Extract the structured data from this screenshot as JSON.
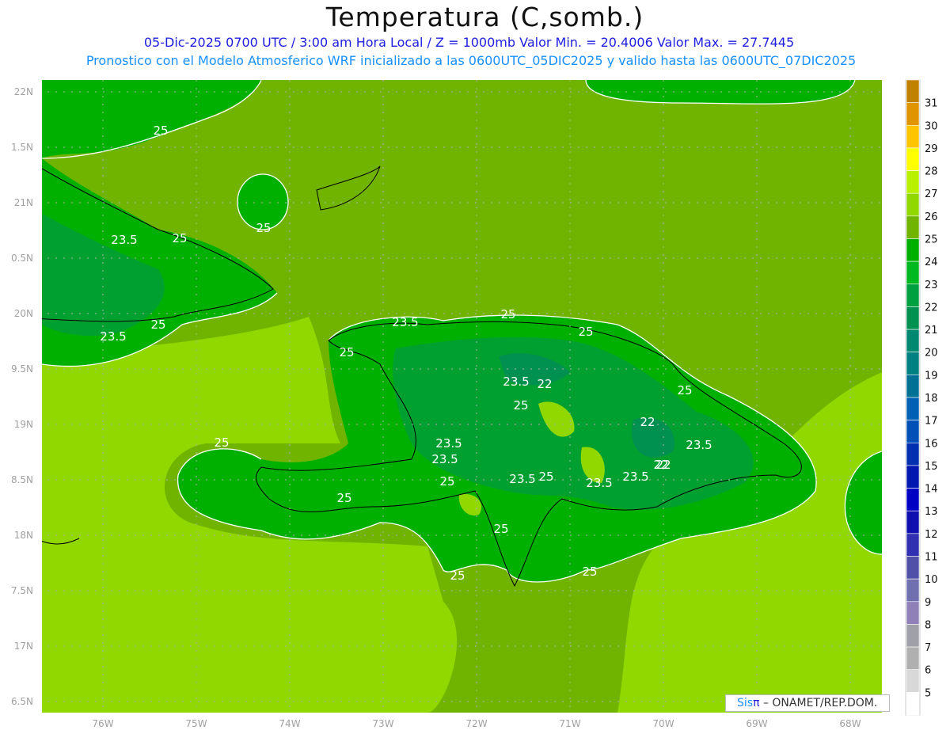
{
  "header": {
    "title": "Temperatura (C,somb.)",
    "subtitle_1": "05-Dic-2025  0700 UTC / 3:00 am Hora Local / Z = 1000mb   Valor Min. = 20.4006  Valor Max. = 27.7445",
    "subtitle_2": "Pronostico con el Modelo Atmosferico WRF inicializado a las 0600UTC_05DIC2025 y valido hasta las  0600UTC_07DIC2025"
  },
  "map": {
    "lat_labels": [
      "22N",
      "1.5N",
      "21N",
      "0.5N",
      "20N",
      "9.5N",
      "19N",
      "8.5N",
      "18N",
      "7.5N",
      "17N",
      "6.5N"
    ],
    "lon_labels": [
      "76W",
      "75W",
      "74W",
      "73W",
      "72W",
      "71W",
      "70W",
      "69W",
      "68W"
    ],
    "contour_labels": [
      "25",
      "25",
      "25",
      "23.5",
      "25",
      "23.5",
      "25",
      "25",
      "23.5",
      "25",
      "23.5",
      "23.5",
      "22",
      "25",
      "22",
      "25",
      "22",
      "23.5",
      "25",
      "23.5",
      "23.5",
      "25",
      "23.5",
      "25",
      "23.5",
      "22",
      "25",
      "25",
      "25",
      "25"
    ]
  },
  "colorbar": {
    "labels": [
      "31",
      "30",
      "29",
      "28",
      "27",
      "26",
      "25",
      "24",
      "23",
      "22",
      "21",
      "20",
      "19",
      "18",
      "17",
      "16",
      "15",
      "14",
      "13",
      "12",
      "11",
      "10",
      "9",
      "8",
      "7",
      "6",
      "5"
    ],
    "colors": [
      "#c08000",
      "#e09400",
      "#ffc400",
      "#ffff00",
      "#b8f000",
      "#90d800",
      "#70b400",
      "#00b000",
      "#00b820",
      "#00a040",
      "#009050",
      "#008870",
      "#008080",
      "#007094",
      "#0060b4",
      "#0050b8",
      "#0030b0",
      "#0018b0",
      "#0000c4",
      "#1010b0",
      "#3030b0",
      "#5050a8",
      "#7070b0",
      "#9080b8",
      "#a0a0a8",
      "#b0b0b0",
      "#d8d8d8",
      "#ffffff"
    ]
  },
  "credit": {
    "sis": "Sis",
    "pi": "π",
    "org": " – ONAMET/REP.DOM."
  }
}
